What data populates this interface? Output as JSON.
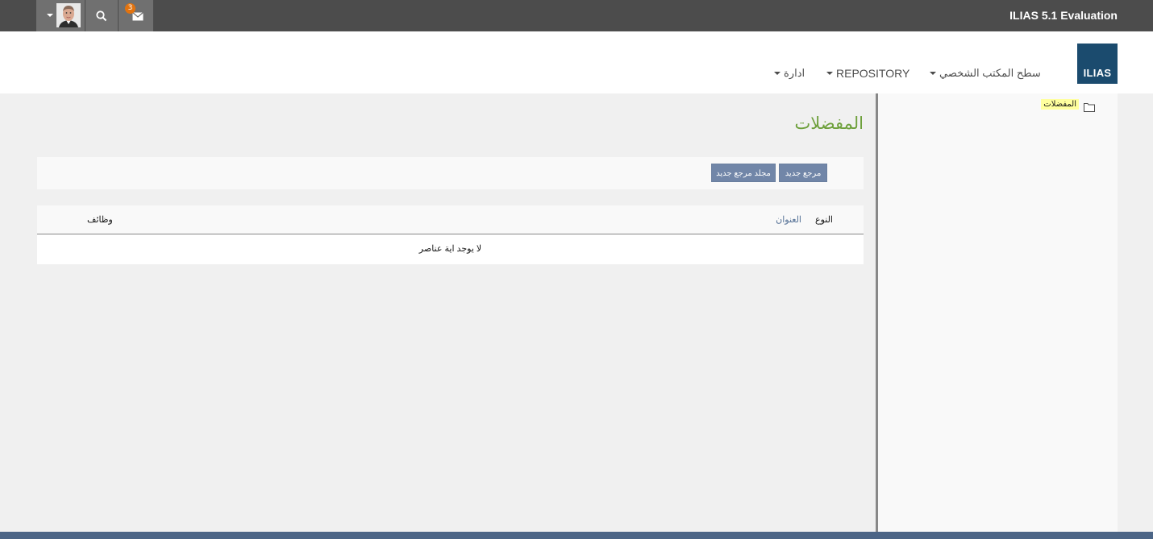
{
  "topbar": {
    "install_title": "ILIAS 5.1 Evaluation",
    "mail_badge": "3",
    "icons": [
      "user-menu-caret-icon",
      "avatar",
      "search-icon",
      "mail-icon"
    ]
  },
  "header": {
    "logo_text": "ILIAS",
    "menu": {
      "personal_desktop": "سطح المكتب الشخصي",
      "repository": "REPOSITORY",
      "administration": "ادارة"
    }
  },
  "main": {
    "page_title": "المفضلات",
    "toolbar": {
      "new_reference": "مرجع جديد",
      "new_reference_category": "مجلد مرجع جديد"
    },
    "table": {
      "columns": {
        "type": "النوع",
        "title": "العنوان",
        "actions": "وظائف"
      },
      "empty_message": "لا يوجد اية عناصر"
    }
  },
  "sidenav": {
    "tree_item": "المفضلات"
  },
  "colors": {
    "topbar": "#4c4c4c",
    "logo": "#1b4b6e",
    "title_green": "#6ea03c",
    "button": "#7186a8",
    "footer": "#4c6586",
    "highlight": "#ffff9e",
    "badge": "#e2730f"
  }
}
